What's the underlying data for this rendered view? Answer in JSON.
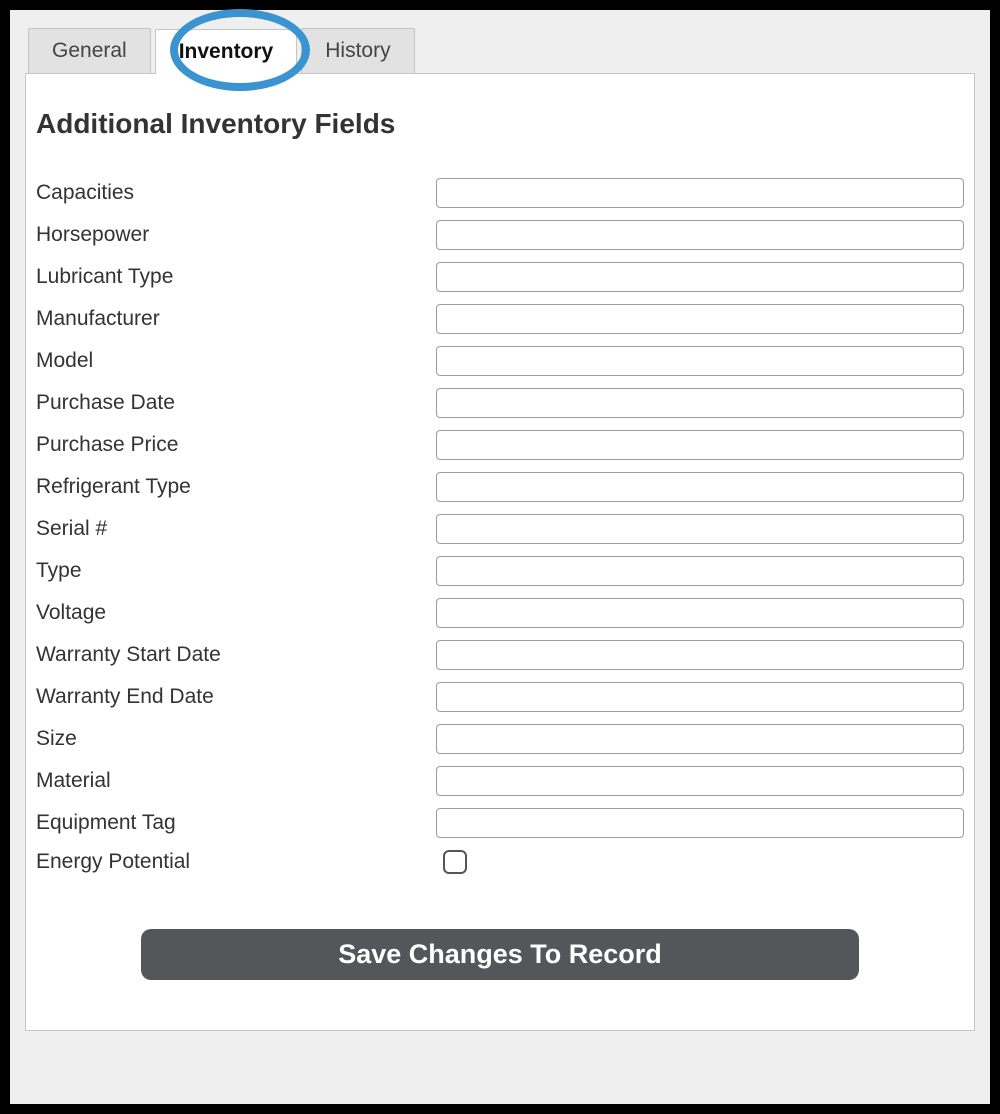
{
  "tabs": {
    "general": "General",
    "inventory": "Inventory",
    "history": "History"
  },
  "heading": "Additional Inventory Fields",
  "fields": {
    "capacities": "Capacities",
    "horsepower": "Horsepower",
    "lubricant_type": "Lubricant Type",
    "manufacturer": "Manufacturer",
    "model": "Model",
    "purchase_date": "Purchase Date",
    "purchase_price": "Purchase Price",
    "refrigerant_type": "Refrigerant Type",
    "serial_no": "Serial #",
    "type": "Type",
    "voltage": "Voltage",
    "warranty_start": "Warranty Start Date",
    "warranty_end": "Warranty End Date",
    "size": "Size",
    "material": "Material",
    "equipment_tag": "Equipment Tag",
    "energy_potential": "Energy Potential"
  },
  "values": {
    "capacities": "",
    "horsepower": "",
    "lubricant_type": "",
    "manufacturer": "",
    "model": "",
    "purchase_date": "",
    "purchase_price": "",
    "refrigerant_type": "",
    "serial_no": "",
    "type": "",
    "voltage": "",
    "warranty_start": "",
    "warranty_end": "",
    "size": "",
    "material": "",
    "equipment_tag": ""
  },
  "save_label": "Save Changes To Record"
}
